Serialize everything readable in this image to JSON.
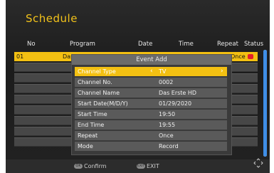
{
  "title": "Schedule",
  "columns": [
    "No",
    "Program",
    "Date",
    "Time",
    "Repeat",
    "Status"
  ],
  "first_row": {
    "no": "01",
    "program": "Das",
    "repeat": "Once"
  },
  "dialog": {
    "title": "Event Add",
    "fields": [
      {
        "label": "Channel Type",
        "value": "TV"
      },
      {
        "label": "Channel No.",
        "value": "0002"
      },
      {
        "label": "Channel Name",
        "value": "Das Erste HD"
      },
      {
        "label": "Start Date(M/D/Y)",
        "value": "01/29/2020"
      },
      {
        "label": "Start Time",
        "value": "19:50"
      },
      {
        "label": "End Time",
        "value": "19:55"
      },
      {
        "label": "Repeat",
        "value": "Once"
      },
      {
        "label": "Mode",
        "value": "Record"
      }
    ]
  },
  "footer": {
    "ok_key": "OK",
    "confirm": "Confirm",
    "exit_key": "EXIT",
    "exit": "EXIT"
  },
  "colors": {
    "accent": "#f3c012",
    "record": "#e4202a",
    "scrollbar": "#3f8ee6"
  }
}
